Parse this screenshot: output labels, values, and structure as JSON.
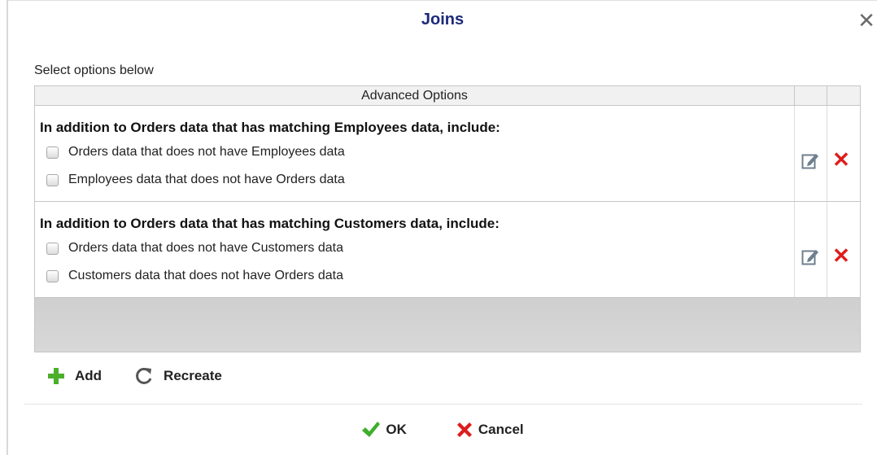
{
  "dialog": {
    "title": "Joins",
    "close_glyph": "✕",
    "subtitle": "Select options below"
  },
  "grid": {
    "header": "Advanced Options",
    "rows": [
      {
        "title": "In addition to Orders data that has matching Employees data, include:",
        "options": [
          {
            "label": "Orders data that does not have Employees data",
            "checked": false
          },
          {
            "label": "Employees data that does not have Orders data",
            "checked": false
          }
        ],
        "edit_icon": "edit-icon",
        "delete_icon": "delete-icon"
      },
      {
        "title": "In addition to Orders data that has matching Customers data, include:",
        "options": [
          {
            "label": "Orders data that does not have Customers data",
            "checked": false
          },
          {
            "label": "Customers data that does not have Orders data",
            "checked": false
          }
        ],
        "edit_icon": "edit-icon",
        "delete_icon": "delete-icon"
      }
    ]
  },
  "toolbar": {
    "add_label": "Add",
    "add_icon": "plus-icon",
    "recreate_label": "Recreate",
    "recreate_icon": "refresh-icon"
  },
  "footer": {
    "ok_label": "OK",
    "ok_icon": "checkmark-icon",
    "cancel_label": "Cancel",
    "cancel_icon": "x-icon"
  },
  "colors": {
    "title": "#1c2a7a",
    "add_green": "#4caf2a",
    "ok_green": "#3eae2b",
    "delete_red": "#dd1d1d"
  }
}
